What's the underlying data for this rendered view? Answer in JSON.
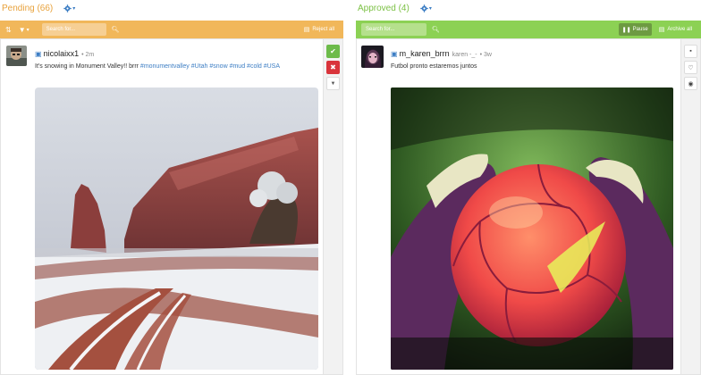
{
  "pending": {
    "title": "Pending (66)",
    "color": "#f1b75a",
    "search_placeholder": "Search for...",
    "reject_all_label": "Reject all",
    "post": {
      "username": "nicolaixx1",
      "time": "• 2m",
      "caption_text": "It's snowing in Monument Valley!! brrr ",
      "hashtags": [
        "#monumentvalley",
        "#Utah",
        "#snow",
        "#mud",
        "#cold",
        "#USA"
      ]
    }
  },
  "approved": {
    "title": "Approved (4)",
    "color": "#8cd154",
    "search_placeholder": "Search for...",
    "pause_label": "Pause",
    "archive_all_label": "Archive all",
    "post": {
      "username": "m_karen_brrn",
      "handle": "karen -_-",
      "time": "• 3w",
      "caption_text": "Futbol pronto estaremos juntos"
    }
  },
  "icons": {
    "settings": "gear-icon",
    "sort": "sort-icon",
    "filter": "filter-icon",
    "search": "search-icon",
    "approve": "check-icon",
    "reject": "close-icon",
    "instagram": "instagram-icon"
  },
  "colors": {
    "link": "#3d7ec4",
    "approve_green": "#6dbb4a",
    "reject_red": "#d9343b"
  }
}
